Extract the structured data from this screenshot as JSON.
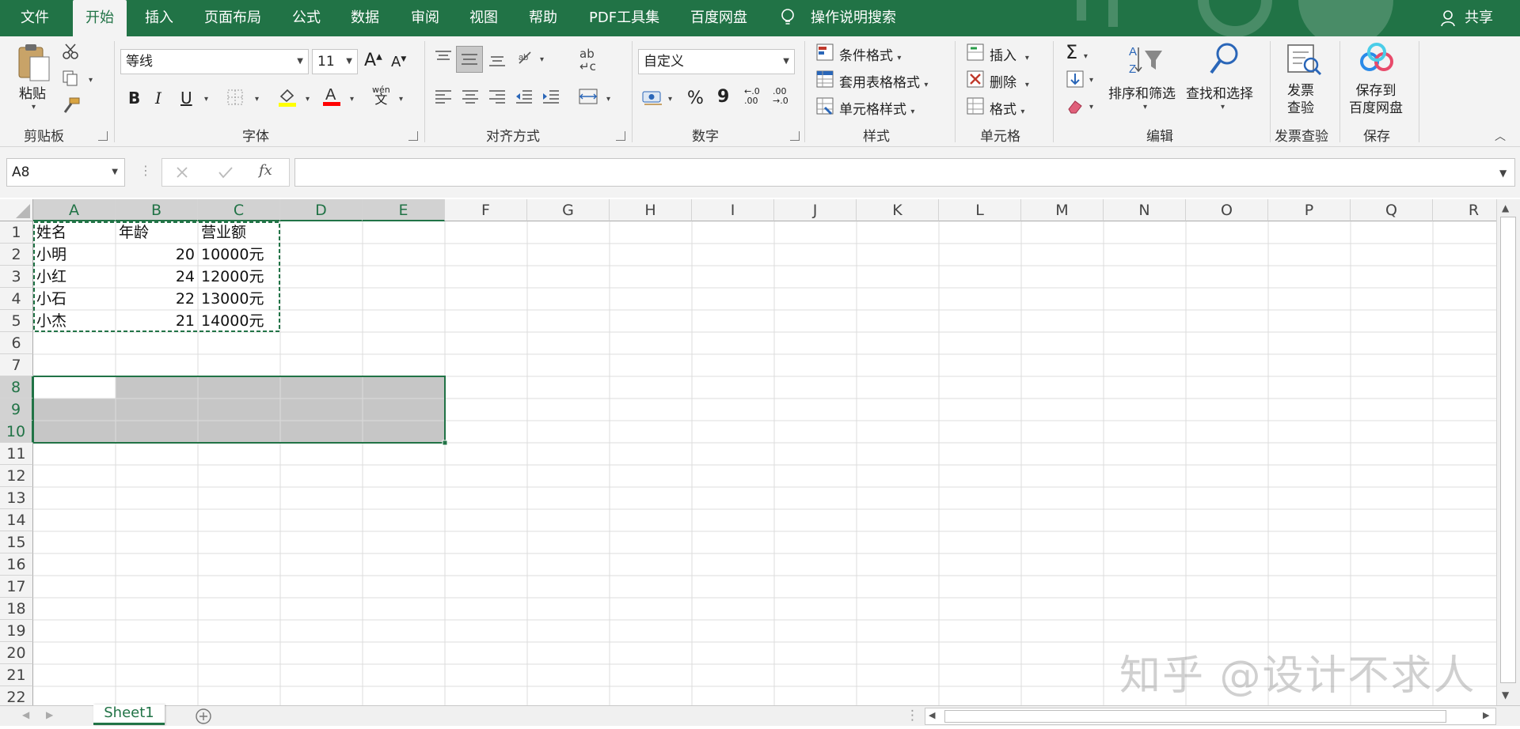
{
  "menu": {
    "tabs": [
      "文件",
      "开始",
      "插入",
      "页面布局",
      "公式",
      "数据",
      "审阅",
      "视图",
      "帮助",
      "PDF工具集",
      "百度网盘"
    ],
    "active_tab": "开始",
    "tell_me": "操作说明搜索",
    "share": "共享"
  },
  "ribbon": {
    "clipboard": {
      "paste": "粘贴",
      "label": "剪贴板"
    },
    "font": {
      "name": "等线",
      "size": "11",
      "label": "字体",
      "bold": "B",
      "italic": "I",
      "underline": "U",
      "grow": "A",
      "shrink": "A",
      "phonetic": "wén"
    },
    "alignment": {
      "label": "对齐方式",
      "wrap_icon": "ab/c"
    },
    "number": {
      "format": "自定义",
      "label": "数字",
      "percent": "%",
      "comma": "9"
    },
    "styles": {
      "conditional": "条件格式",
      "table": "套用表格格式",
      "cell_styles": "单元格样式",
      "label": "样式"
    },
    "cells": {
      "insert": "插入",
      "delete": "删除",
      "format": "格式",
      "label": "单元格"
    },
    "editing": {
      "sort_filter": "排序和筛选",
      "find_select": "查找和选择",
      "label": "编辑",
      "sigma": "Σ"
    },
    "invoice": {
      "check_line1": "发票",
      "check_line2": "查验",
      "label": "发票查验"
    },
    "save": {
      "line1": "保存到",
      "line2": "百度网盘",
      "label": "保存"
    }
  },
  "formula_bar": {
    "name_box": "A8",
    "fx": "fx",
    "formula": ""
  },
  "columns": [
    "A",
    "B",
    "C",
    "D",
    "E",
    "F",
    "G",
    "H",
    "I",
    "J",
    "K",
    "L",
    "M",
    "N",
    "O",
    "P",
    "Q",
    "R"
  ],
  "rows": [
    "1",
    "2",
    "3",
    "4",
    "5",
    "6",
    "7",
    "8",
    "9",
    "10",
    "11",
    "12",
    "13",
    "14",
    "15",
    "16",
    "17",
    "18",
    "19",
    "20",
    "21",
    "22"
  ],
  "table": {
    "headers": [
      "姓名",
      "年龄",
      "营业额"
    ],
    "data": [
      [
        "小明",
        "20",
        "10000元"
      ],
      [
        "小红",
        "24",
        "12000元"
      ],
      [
        "小石",
        "22",
        "13000元"
      ],
      [
        "小杰",
        "21",
        "14000元"
      ]
    ]
  },
  "selection": {
    "range": "A8:E10",
    "active_cell": "A8",
    "copy_range": "A1:C5"
  },
  "sheet": {
    "tab": "Sheet1"
  },
  "watermark": "知乎 @设计不求人",
  "colors": {
    "excel_green": "#217346",
    "selection_fill": "#c6c6c6",
    "ribbon_bg": "#f3f3f3"
  }
}
